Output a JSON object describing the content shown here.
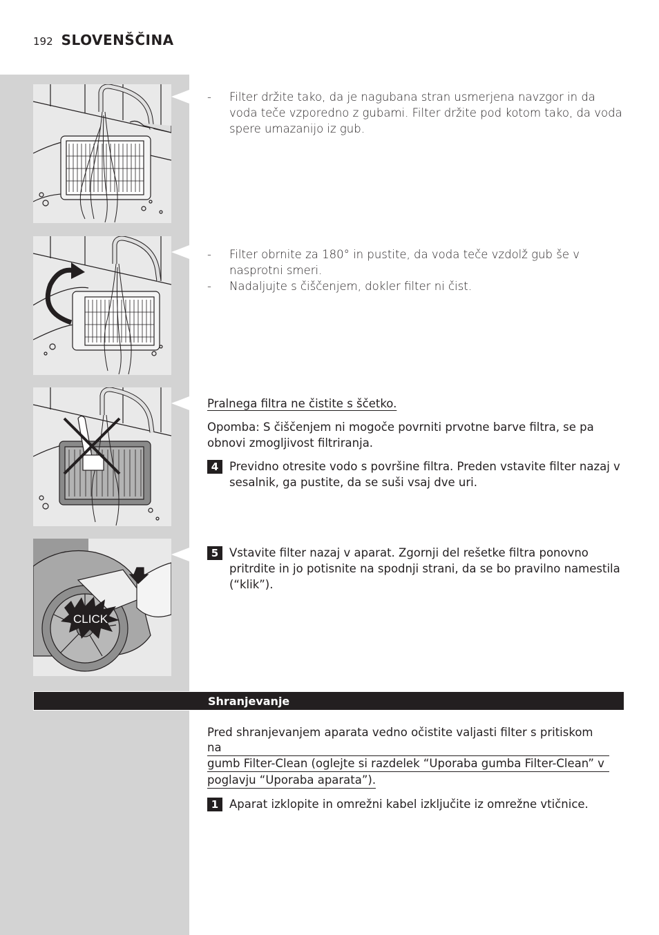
{
  "header": {
    "page_number": "192",
    "language": "SLOVENŠČINA"
  },
  "figures": [
    {
      "label": "rinse-filter-pleats-up",
      "caption_icon": "faucet-water-filter"
    },
    {
      "label": "rotate-filter-180",
      "caption_icon": "rotate-arrow"
    },
    {
      "label": "no-brush",
      "caption_icon": "cross-out"
    },
    {
      "label": "reinsert-filter",
      "badge": "CLICK"
    }
  ],
  "blocks": {
    "b1": {
      "bullets": [
        "Filter držite tako, da je nagubana stran usmerjena navzgor in da voda teče vzporedno z gubami. Filter držite pod kotom tako, da voda spere umazanijo iz gub."
      ]
    },
    "b2": {
      "bullets": [
        "Filter obrnite za 180° in pustite, da voda teče vzdolž gub še v nasprotni smeri.",
        "Nadaljujte s čiščenjem, dokler filter ni čist."
      ]
    },
    "b3": {
      "warning": "Pralnega filtra ne čistite s ščetko.",
      "note": "Opomba: S čiščenjem ni mogoče povrniti prvotne barve filtra, se pa obnovi zmogljivost filtriranja.",
      "step": {
        "number": "4",
        "text": "Previdno otresite vodo s površine filtra. Preden vstavite filter nazaj v sesalnik, ga pustite, da se suši vsaj dve uri."
      }
    },
    "b4": {
      "step": {
        "number": "5",
        "text": "Vstavite filter nazaj v aparat. Zgornji del rešetke filtra ponovno pritrdite in jo potisnite na spodnji strani, da se bo pravilno namestila (“klik”)."
      }
    }
  },
  "section": {
    "title": "Shranjevanje",
    "intro_lines": [
      "Pred shranjevanjem aparata vedno očistite valjasti filter s pritiskom na",
      "gumb Filter-Clean (oglejte si razdelek “Uporaba gumba Filter-Clean” v",
      "poglavju “Uporaba aparata”)."
    ],
    "step": {
      "number": "1",
      "text": "Aparat izklopite in omrežni kabel izključite iz omrežne vtičnice."
    }
  },
  "colors": {
    "ink": "#231f20",
    "sidebar": "#d3d3d3",
    "panel": "#e9e9e9"
  }
}
